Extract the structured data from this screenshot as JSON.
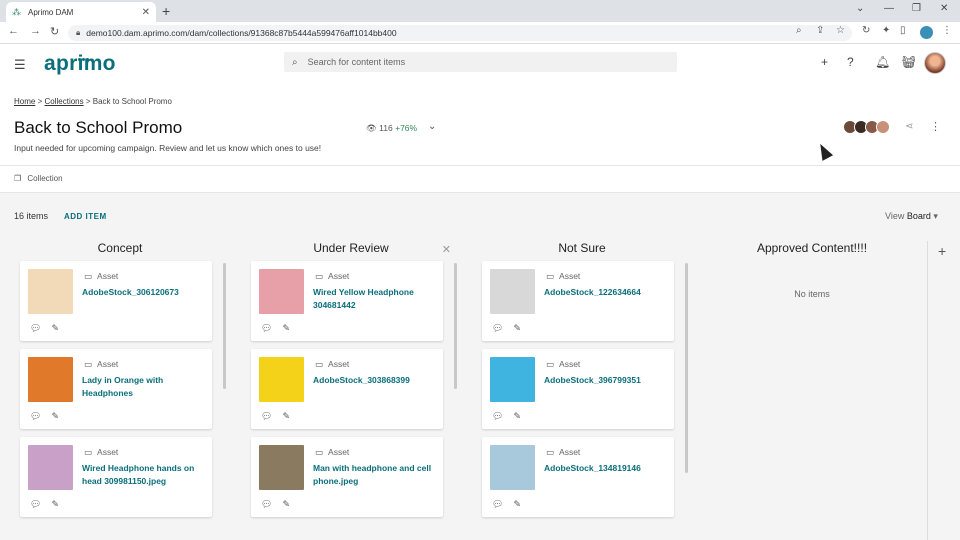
{
  "browser": {
    "tab_title": "Aprimo DAM",
    "tab_close": "✕",
    "new_tab": "+",
    "url": "demo100.dam.aprimo.com/dam/collections/91368c87b5444a599476aff1014bb400",
    "window_controls": [
      "⌄",
      "—",
      "❐",
      "✕"
    ]
  },
  "header": {
    "logo": "aprimo",
    "search_placeholder": "Search for content items"
  },
  "breadcrumb": {
    "home": "Home",
    "collections": "Collections",
    "current": "Back to School Promo",
    "sep": ">"
  },
  "page": {
    "title": "Back to School Promo",
    "subtitle": "Input needed for upcoming campaign. Review and let us know which ones to use!",
    "views": "116",
    "views_pct": "+76%",
    "collection_label": "Collection"
  },
  "board": {
    "items_count": "16 items",
    "add_item": "ADD ITEM",
    "view_label": "View",
    "view_value": "Board",
    "columns": [
      {
        "title": "Concept",
        "cards": [
          {
            "type": "Asset",
            "name": "AdobeStock_306120673",
            "thumb": "#f2d9b8"
          },
          {
            "type": "Asset",
            "name": "Lady in Orange with Headphones",
            "thumb": "#e07a2a"
          },
          {
            "type": "Asset",
            "name": "Wired Headphone hands on head 309981150.jpeg",
            "thumb": "#c9a0c8"
          }
        ]
      },
      {
        "title": "Under Review",
        "cards": [
          {
            "type": "Asset",
            "name": "Wired Yellow Headphone 304681442",
            "thumb": "#e8a0a8"
          },
          {
            "type": "Asset",
            "name": "AdobeStock_303868399",
            "thumb": "#f5d21a"
          },
          {
            "type": "Asset",
            "name": "Man with headphone and cell phone.jpeg",
            "thumb": "#8a7a60"
          }
        ]
      },
      {
        "title": "Not Sure",
        "cards": [
          {
            "type": "Asset",
            "name": "AdobeStock_122634664",
            "thumb": "#d8d8d8"
          },
          {
            "type": "Asset",
            "name": "AdobeStock_396799351",
            "thumb": "#3fb4e0"
          },
          {
            "type": "Asset",
            "name": "AdobeStock_134819146",
            "thumb": "#a8c8dc"
          }
        ]
      },
      {
        "title": "Approved Content!!!!",
        "empty_text": "No items"
      }
    ]
  }
}
